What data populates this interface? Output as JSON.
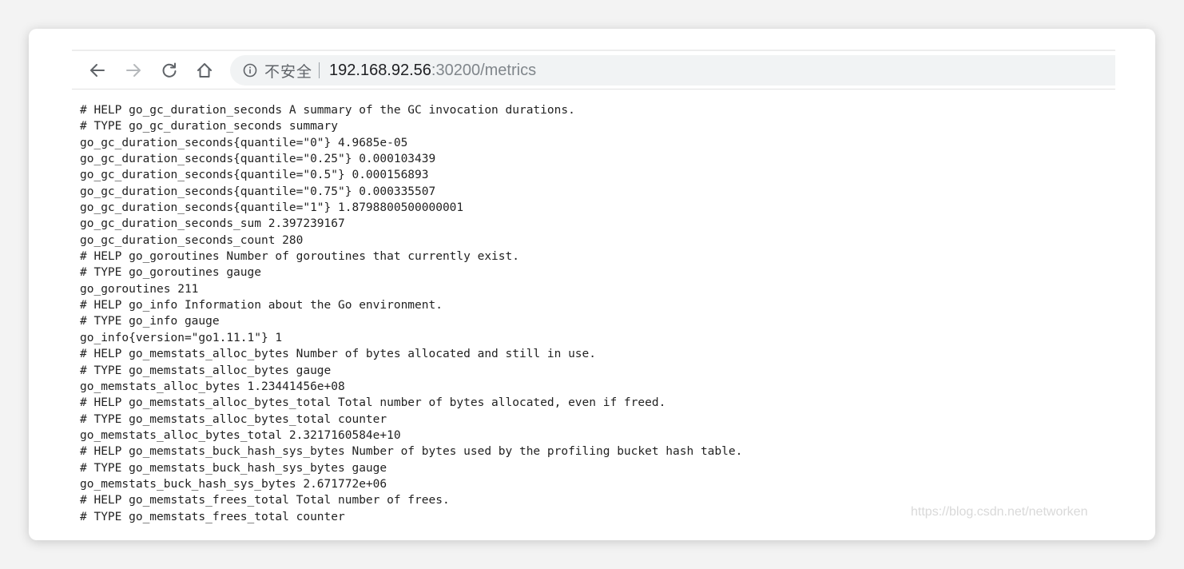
{
  "browser": {
    "security_label": "不安全",
    "url_host": "192.168.92.56",
    "url_rest": ":30200/metrics",
    "icons": {
      "back": "arrow-left-icon",
      "forward": "arrow-right-icon",
      "reload": "reload-icon",
      "home": "home-icon",
      "info": "info-circle-icon"
    }
  },
  "metrics": [
    "# HELP go_gc_duration_seconds A summary of the GC invocation durations.",
    "# TYPE go_gc_duration_seconds summary",
    "go_gc_duration_seconds{quantile=\"0\"} 4.9685e-05",
    "go_gc_duration_seconds{quantile=\"0.25\"} 0.000103439",
    "go_gc_duration_seconds{quantile=\"0.5\"} 0.000156893",
    "go_gc_duration_seconds{quantile=\"0.75\"} 0.000335507",
    "go_gc_duration_seconds{quantile=\"1\"} 1.8798800500000001",
    "go_gc_duration_seconds_sum 2.397239167",
    "go_gc_duration_seconds_count 280",
    "# HELP go_goroutines Number of goroutines that currently exist.",
    "# TYPE go_goroutines gauge",
    "go_goroutines 211",
    "# HELP go_info Information about the Go environment.",
    "# TYPE go_info gauge",
    "go_info{version=\"go1.11.1\"} 1",
    "# HELP go_memstats_alloc_bytes Number of bytes allocated and still in use.",
    "# TYPE go_memstats_alloc_bytes gauge",
    "go_memstats_alloc_bytes 1.23441456e+08",
    "# HELP go_memstats_alloc_bytes_total Total number of bytes allocated, even if freed.",
    "# TYPE go_memstats_alloc_bytes_total counter",
    "go_memstats_alloc_bytes_total 2.3217160584e+10",
    "# HELP go_memstats_buck_hash_sys_bytes Number of bytes used by the profiling bucket hash table.",
    "# TYPE go_memstats_buck_hash_sys_bytes gauge",
    "go_memstats_buck_hash_sys_bytes 2.671772e+06",
    "# HELP go_memstats_frees_total Total number of frees.",
    "# TYPE go_memstats_frees_total counter"
  ],
  "watermark": "https://blog.csdn.net/networken"
}
